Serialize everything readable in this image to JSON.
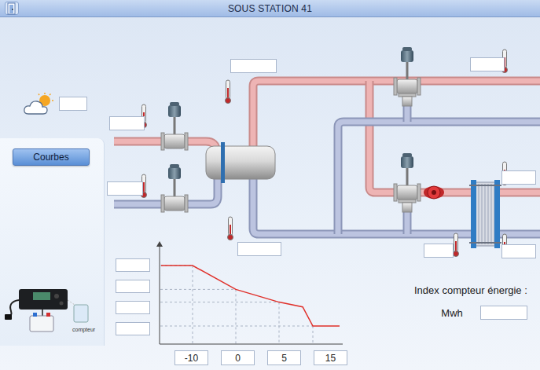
{
  "window": {
    "title": "SOUS STATION 41"
  },
  "weather": {
    "value": ""
  },
  "buttons": [
    {
      "label": "Courbes"
    }
  ],
  "sensors": [
    {
      "value": ""
    },
    {
      "value": ""
    },
    {
      "value": ""
    },
    {
      "value": ""
    },
    {
      "value": ""
    },
    {
      "value": ""
    },
    {
      "value": ""
    },
    {
      "value": ""
    }
  ],
  "meter": {
    "label": "compteur"
  },
  "energy": {
    "label": "Index compteur énergie :",
    "unit": "Mwh",
    "value": ""
  },
  "chart": {
    "x_ticks": [
      "-10",
      "0",
      "5",
      "15"
    ],
    "y_ticks": [
      "",
      "",
      "",
      ""
    ],
    "series": [
      {
        "x": [
          -15,
          -10,
          0,
          5,
          12,
          15,
          20
        ],
        "values": [
          70,
          70,
          55,
          47,
          44,
          32,
          32
        ]
      }
    ]
  }
}
